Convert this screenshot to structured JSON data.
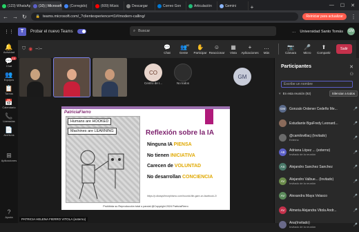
{
  "browser": {
    "tabs": [
      {
        "label": "(123) WhatsApp",
        "color": "#25d366",
        "active": false
      },
      {
        "label": "(10) | Microsoft",
        "color": "#5b5fc7",
        "active": true
      },
      {
        "label": "(Corregido)",
        "color": "#4285f4",
        "active": false
      },
      {
        "label": "(609) Músic",
        "color": "#ff0000",
        "active": false
      },
      {
        "label": "Descargar",
        "color": "#888888",
        "active": false
      },
      {
        "label": "Correo Gon",
        "color": "#0078d4",
        "active": false
      },
      {
        "label": "Articulación",
        "color": "#2b7",
        "active": false
      },
      {
        "label": "Gemini",
        "color": "#8ab4f8",
        "active": false
      }
    ],
    "url": "teams.microsoft.com/_?clientexperience=t1#/modern-calling/",
    "update_button": "Reiniciar para actualizar"
  },
  "teams": {
    "try_new": "Probar el nuevo Teams",
    "search_placeholder": "Buscar",
    "org": "Universidad Santo Tomás",
    "user_initials": "GM"
  },
  "rail": [
    {
      "label": "Actividad",
      "icon": "🔔",
      "badge": ""
    },
    {
      "label": "Chat",
      "icon": "💬",
      "badge": "10"
    },
    {
      "label": "Equipos",
      "icon": "👥",
      "badge": ""
    },
    {
      "label": "Tareas",
      "icon": "📋",
      "badge": ""
    },
    {
      "label": "Calendario",
      "icon": "📅",
      "badge": ""
    },
    {
      "label": "Llamadas",
      "icon": "📞",
      "badge": ""
    },
    {
      "label": "Archivos",
      "icon": "📄",
      "badge": ""
    },
    {
      "label": "Aplicaciones",
      "icon": "⊞",
      "badge": ""
    },
    {
      "label": "Ayuda",
      "icon": "?",
      "badge": ""
    }
  ],
  "meeting": {
    "timer": "--:--",
    "controls": [
      {
        "label": "Chat",
        "icon": "💬"
      },
      {
        "label": "Gente",
        "icon": "👥",
        "count": "92"
      },
      {
        "label": "Participar",
        "icon": "✋"
      },
      {
        "label": "Reaccionar",
        "icon": "☺"
      },
      {
        "label": "Vista",
        "icon": "▦"
      },
      {
        "label": "Aplicaciones",
        "icon": "+"
      },
      {
        "label": "Más",
        "icon": "…"
      },
      {
        "label": "Cámara",
        "icon": "📷"
      },
      {
        "label": "Micro",
        "icon": "🎤"
      },
      {
        "label": "Compartir",
        "icon": "⬆"
      }
    ],
    "leave": "Salir"
  },
  "stage": {
    "tiles": [
      {
        "skin": "#c9a27e",
        "cloth": "#1a1a1a",
        "bg": "#3a3530"
      },
      {
        "skin": "#e0a98a",
        "cloth": "#c8203a",
        "bg": "#5a4a40"
      },
      {
        "skin": "#c99a7a",
        "cloth": "#2b3a55",
        "bg": "#6a6258"
      }
    ],
    "avatars": [
      {
        "initials": "CO",
        "name": "Centro de I...",
        "color": "#e8d5cc",
        "text": "#6b3b2b"
      },
      {
        "initials": "",
        "name": "No todos",
        "color": "#2d2d2d",
        "text": "#ccc"
      },
      {
        "initials": "GM",
        "name": "",
        "color": "#c8ccd9",
        "text": "#3b4060"
      }
    ],
    "presenter_caption": "PATRICIA HELENA FIERRO VITOLA (externo)"
  },
  "slide": {
    "brand": "PatriciaFierro",
    "hooked": "Humans are HOOKED",
    "learning": "Machines are LEARNING",
    "title": "Reflexión sobre la IA",
    "lines": [
      {
        "pre": "Ninguna IA ",
        "hl": "PIENSA"
      },
      {
        "pre": "No tienen ",
        "hl": "INICIATIVA"
      },
      {
        "pre": "Carecen de ",
        "hl": "VOLUNTAD"
      },
      {
        "pre": "No desarrollan ",
        "hl": "CONCIENCIA"
      }
    ],
    "link": "https://p.dlways/fmorphismo.com/hoontd-file-gare-on-facebook-2/",
    "footer": "Prohibida su Reproducción total o parcial @Copyright 2024 PatriciaFierro",
    "accent": "#7b1e6b"
  },
  "panel": {
    "title": "Participantes",
    "search_placeholder": "Escribe un nombre",
    "section": "En esta reunión (92)",
    "silence": "Silenciar a todos",
    "people": [
      {
        "initials": "GM",
        "name": "Gonzalo Ordener Cedeño Me...",
        "sub": "",
        "color": "#5a6a8a"
      },
      {
        "initials": "",
        "name": "Estudiante BgaFredy Leonard...",
        "sub": "",
        "color": "#8a6a5a"
      },
      {
        "initials": "",
        "name": "@camilovillacj (Invitado)",
        "sub": "Externo",
        "color": "#6a6a6a"
      },
      {
        "initials": "AB",
        "name": "Adriana López ... (externo)",
        "sub": "Invitado de la reunión",
        "color": "#5b5fc7"
      },
      {
        "initials": "AS",
        "name": "Alejandro Sanchez Sanchez",
        "sub": "",
        "color": "#4a7a6a"
      },
      {
        "initials": "AV",
        "name": "Alejandro Valbue... (Invitado)",
        "sub": "Invitado de la reunión",
        "color": "#6a8a4a"
      },
      {
        "initials": "AV",
        "name": "Alexandra Maya Velasco",
        "sub": "",
        "color": "#5a8a5a"
      },
      {
        "initials": "AV",
        "name": "Almeria Alejandra Vitola Andr...",
        "sub": "",
        "color": "#c4314b"
      },
      {
        "initials": "",
        "name": "Ana(Invitado)",
        "sub": "Invitado de la reunión",
        "color": "#6a6a8a"
      }
    ]
  }
}
